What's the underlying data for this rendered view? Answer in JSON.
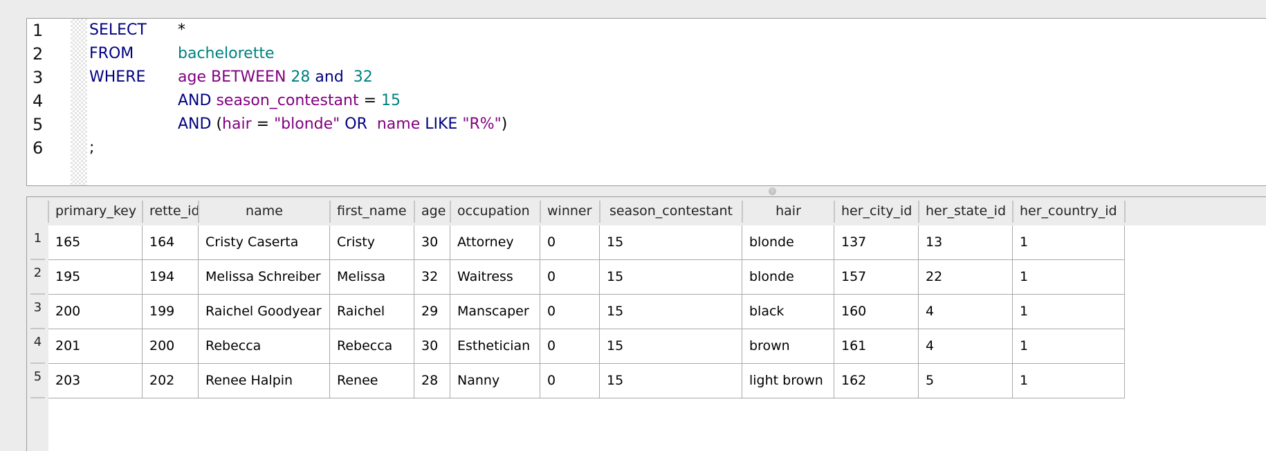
{
  "editor": {
    "line_numbers": [
      "1",
      "2",
      "3",
      "4",
      "5",
      "6"
    ],
    "lines": [
      [
        {
          "t": "SELECT",
          "c": "kw",
          "col": true
        },
        {
          "t": "*",
          "c": "plain"
        }
      ],
      [
        {
          "t": "FROM",
          "c": "kw",
          "col": true
        },
        {
          "t": "bachelorette",
          "c": "tbl"
        }
      ],
      [
        {
          "t": "WHERE",
          "c": "kw",
          "col": true
        },
        {
          "t": "age BETWEEN ",
          "c": "id"
        },
        {
          "t": "28",
          "c": "num"
        },
        {
          "t": " and ",
          "c": "kw"
        },
        {
          "t": " 32",
          "c": "num"
        }
      ],
      [
        {
          "t": "",
          "c": "plain",
          "col": true
        },
        {
          "t": "AND ",
          "c": "kw"
        },
        {
          "t": "season_contestant",
          "c": "id"
        },
        {
          "t": " = ",
          "c": "plain"
        },
        {
          "t": "15",
          "c": "num"
        }
      ],
      [
        {
          "t": "",
          "c": "plain",
          "col": true
        },
        {
          "t": "AND ",
          "c": "kw"
        },
        {
          "t": "(",
          "c": "plain"
        },
        {
          "t": "hair",
          "c": "id"
        },
        {
          "t": " = ",
          "c": "plain"
        },
        {
          "t": "\"blonde\"",
          "c": "str"
        },
        {
          "t": " OR ",
          "c": "kw"
        },
        {
          "t": " name",
          "c": "id"
        },
        {
          "t": " LIKE ",
          "c": "kw"
        },
        {
          "t": "\"R%\"",
          "c": "str"
        },
        {
          "t": ")",
          "c": "plain"
        }
      ],
      [
        {
          "t": ";",
          "c": "plain"
        }
      ]
    ],
    "syntax_colors": {
      "keyword": "#000080",
      "identifier": "#800080",
      "number": "#008080",
      "table": "#008080",
      "string": "#800080",
      "plain": "#000000"
    }
  },
  "results": {
    "columns": [
      {
        "key": "primary_key",
        "label": "primary_key"
      },
      {
        "key": "rette_id",
        "label": "rette_id"
      },
      {
        "key": "name",
        "label": "name",
        "center": true
      },
      {
        "key": "first_name",
        "label": "first_name"
      },
      {
        "key": "age",
        "label": "age"
      },
      {
        "key": "occupation",
        "label": "occupation"
      },
      {
        "key": "winner",
        "label": "winner"
      },
      {
        "key": "season_contestant",
        "label": "season_contestant",
        "center": true
      },
      {
        "key": "hair",
        "label": "hair",
        "center": true
      },
      {
        "key": "her_city_id",
        "label": "her_city_id"
      },
      {
        "key": "her_state_id",
        "label": "her_state_id"
      },
      {
        "key": "her_country_id",
        "label": "her_country_id"
      }
    ],
    "row_numbers": [
      "1",
      "2",
      "3",
      "4",
      "5"
    ],
    "rows": [
      [
        "165",
        "164",
        "Cristy Caserta",
        "Cristy",
        "30",
        "Attorney",
        "0",
        "15",
        "blonde",
        "137",
        "13",
        "1"
      ],
      [
        "195",
        "194",
        "Melissa Schreiber",
        "Melissa",
        "32",
        "Waitress",
        "0",
        "15",
        "blonde",
        "157",
        "22",
        "1"
      ],
      [
        "200",
        "199",
        "Raichel Goodyear",
        "Raichel",
        "29",
        "Manscaper",
        "0",
        "15",
        "black",
        "160",
        "4",
        "1"
      ],
      [
        "201",
        "200",
        "Rebecca",
        "Rebecca",
        "30",
        "Esthetician",
        "0",
        "15",
        "brown",
        "161",
        "4",
        "1"
      ],
      [
        "203",
        "202",
        "Renee Halpin",
        "Renee",
        "28",
        "Nanny",
        "0",
        "15",
        "light brown",
        "162",
        "5",
        "1"
      ]
    ]
  }
}
